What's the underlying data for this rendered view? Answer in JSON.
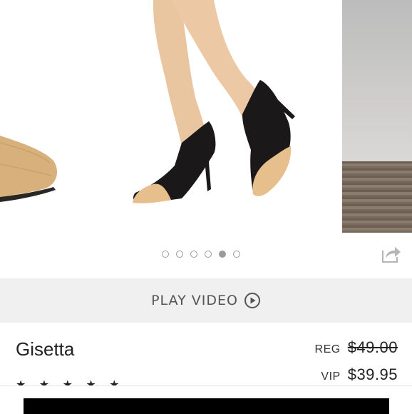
{
  "carousel": {
    "slide_count": 6,
    "active_index": 4,
    "main_image": "shoe-model-image",
    "next_image": "room-preview-image"
  },
  "actions": {
    "share_icon": "share-icon"
  },
  "video": {
    "label": "PLAY VIDEO",
    "icon": "play-circle-icon"
  },
  "product": {
    "name": "Gisetta",
    "rating_stars": "★ ★ ★ ★ ★",
    "rating": 5
  },
  "pricing": {
    "reg_label": "REG",
    "reg_price": "$49.00",
    "vip_label": "VIP",
    "vip_price": "$39.95"
  },
  "colors": {
    "video_bar_bg": "#f0f0f0",
    "cta_bg": "#000000",
    "dot_color": "#9a9a9a"
  }
}
